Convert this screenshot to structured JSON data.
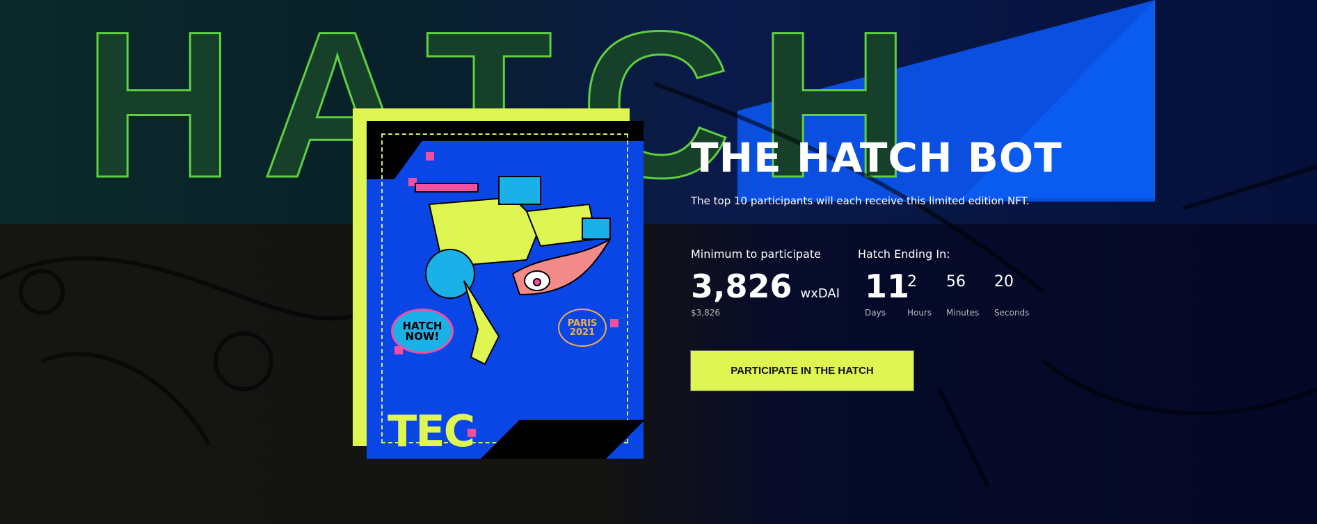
{
  "background": {
    "lettering": "HATCH"
  },
  "nft": {
    "bubble_text": "HATCH NOW!",
    "city_text": "PARIS 2021",
    "logo_text": "TEC",
    "colors": {
      "frame": "#dff552",
      "art_blue": "#0a46e6",
      "pink": "#f050a0"
    }
  },
  "hero": {
    "title": "THE HATCH BOT",
    "subtitle": "The top 10 participants will each receive this limited edition NFT."
  },
  "minimum": {
    "label": "Minimum to participate",
    "amount": "3,826",
    "currency": "wxDAI",
    "usd": "$3,826"
  },
  "countdown": {
    "label": "Hatch Ending In:",
    "units": [
      {
        "value": "11",
        "unit": "Days"
      },
      {
        "value": "2",
        "unit": "Hours"
      },
      {
        "value": "56",
        "unit": "Minutes"
      },
      {
        "value": "20",
        "unit": "Seconds"
      }
    ]
  },
  "cta": {
    "label": "PARTICIPATE IN THE HATCH",
    "color": "#dff552"
  }
}
